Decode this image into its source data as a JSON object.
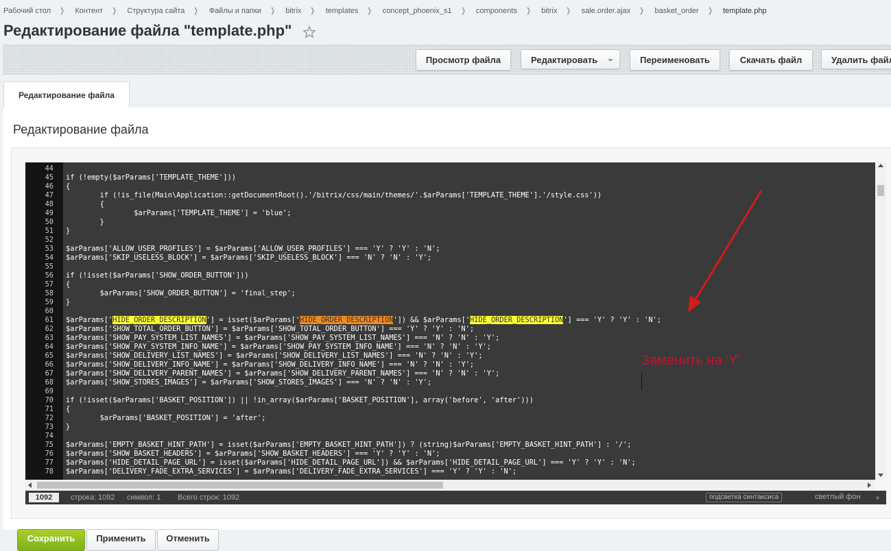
{
  "breadcrumbs": [
    "Рабочий стол",
    "Контент",
    "Структура сайта",
    "Файлы и папки",
    "bitrix",
    "templates",
    "concept_phoenix_s1",
    "components",
    "bitrix",
    "sale.order.ajax",
    "basket_order",
    "template.php"
  ],
  "page_title": "Редактирование файла \"template.php\"",
  "toolbar": {
    "view_file": "Просмотр файла",
    "edit": "Редактировать",
    "rename": "Переименовать",
    "download": "Скачать файл",
    "delete": "Удалить файл"
  },
  "tab_label": "Редактирование файла",
  "section_title": "Редактирование файла",
  "editor": {
    "lines": [
      {
        "n": "44",
        "parts": [
          {
            "t": ""
          }
        ]
      },
      {
        "n": "45",
        "parts": [
          {
            "t": "if (!empty($arParams['TEMPLATE_THEME']))"
          }
        ]
      },
      {
        "n": "46",
        "parts": [
          {
            "t": "{"
          }
        ]
      },
      {
        "n": "47",
        "parts": [
          {
            "t": "\tif (!is_file(Main\\Application::getDocumentRoot().'/bitrix/css/main/themes/'.$arParams['TEMPLATE_THEME'].'/style.css'))"
          }
        ]
      },
      {
        "n": "48",
        "parts": [
          {
            "t": "\t{"
          }
        ]
      },
      {
        "n": "49",
        "parts": [
          {
            "t": "\t\t$arParams['TEMPLATE_THEME'] = 'blue';"
          }
        ]
      },
      {
        "n": "50",
        "parts": [
          {
            "t": "\t}"
          }
        ]
      },
      {
        "n": "51",
        "parts": [
          {
            "t": "}"
          }
        ]
      },
      {
        "n": "52",
        "parts": [
          {
            "t": ""
          }
        ]
      },
      {
        "n": "53",
        "parts": [
          {
            "t": "$arParams['ALLOW_USER_PROFILES'] = $arParams['ALLOW_USER_PROFILES'] === 'Y' ? 'Y' : 'N';"
          }
        ]
      },
      {
        "n": "54",
        "parts": [
          {
            "t": "$arParams['SKIP_USELESS_BLOCK'] = $arParams['SKIP_USELESS_BLOCK'] === 'N' ? 'N' : 'Y';"
          }
        ]
      },
      {
        "n": "55",
        "parts": [
          {
            "t": ""
          }
        ]
      },
      {
        "n": "56",
        "parts": [
          {
            "t": "if (!isset($arParams['SHOW_ORDER_BUTTON']))"
          }
        ]
      },
      {
        "n": "57",
        "parts": [
          {
            "t": "{"
          }
        ]
      },
      {
        "n": "58",
        "parts": [
          {
            "t": "\t$arParams['SHOW_ORDER_BUTTON'] = 'final_step';"
          }
        ]
      },
      {
        "n": "59",
        "parts": [
          {
            "t": "}"
          }
        ]
      },
      {
        "n": "60",
        "parts": [
          {
            "t": ""
          }
        ]
      },
      {
        "n": "61",
        "parts": [
          {
            "t": "$arParams['"
          },
          {
            "t": "HIDE_ORDER_DESCRIPTION",
            "hl": "yellow"
          },
          {
            "t": "'] = isset($arParams['"
          },
          {
            "t": "HIDE_ORDER_DESCRIPTION",
            "hl": "orange"
          },
          {
            "t": "']) && $arParams['"
          },
          {
            "t": "HIDE_ORDER_DESCRIPTION",
            "hl": "yellow"
          },
          {
            "t": "'] === 'Y' ? 'Y' : 'N';"
          }
        ]
      },
      {
        "n": "62",
        "parts": [
          {
            "t": "$arParams['SHOW_TOTAL_ORDER_BUTTON'] = $arParams['SHOW_TOTAL_ORDER_BUTTON'] === 'Y' ? 'Y' : 'N';"
          }
        ]
      },
      {
        "n": "63",
        "parts": [
          {
            "t": "$arParams['SHOW_PAY_SYSTEM_LIST_NAMES'] = $arParams['SHOW_PAY_SYSTEM_LIST_NAMES'] === 'N' ? 'N' : 'Y';"
          }
        ]
      },
      {
        "n": "64",
        "parts": [
          {
            "t": "$arParams['SHOW_PAY_SYSTEM_INFO_NAME'] = $arParams['SHOW_PAY_SYSTEM_INFO_NAME'] === 'N' ? 'N' : 'Y';"
          }
        ]
      },
      {
        "n": "65",
        "parts": [
          {
            "t": "$arParams['SHOW_DELIVERY_LIST_NAMES'] = $arParams['SHOW_DELIVERY_LIST_NAMES'] === 'N' ? 'N' : 'Y';"
          }
        ]
      },
      {
        "n": "66",
        "parts": [
          {
            "t": "$arParams['SHOW_DELIVERY_INFO_NAME'] = $arParams['SHOW_DELIVERY_INFO_NAME'] === 'N' ? 'N' : 'Y';"
          }
        ]
      },
      {
        "n": "67",
        "parts": [
          {
            "t": "$arParams['SHOW_DELIVERY_PARENT_NAMES'] = $arParams['SHOW_DELIVERY_PARENT_NAMES'] === 'N' ? 'N' : 'Y';"
          }
        ]
      },
      {
        "n": "68",
        "parts": [
          {
            "t": "$arParams['SHOW_STORES_IMAGES'] = $arParams['SHOW_STORES_IMAGES'] === 'N' ? 'N' : 'Y';"
          }
        ]
      },
      {
        "n": "69",
        "parts": [
          {
            "t": ""
          }
        ]
      },
      {
        "n": "70",
        "parts": [
          {
            "t": "if (!isset($arParams['BASKET_POSITION']) || !in_array($arParams['BASKET_POSITION'], array('before', 'after')))"
          }
        ]
      },
      {
        "n": "71",
        "parts": [
          {
            "t": "{"
          }
        ]
      },
      {
        "n": "72",
        "parts": [
          {
            "t": "\t$arParams['BASKET_POSITION'] = 'after';"
          }
        ]
      },
      {
        "n": "73",
        "parts": [
          {
            "t": "}"
          }
        ]
      },
      {
        "n": "74",
        "parts": [
          {
            "t": ""
          }
        ]
      },
      {
        "n": "75",
        "parts": [
          {
            "t": "$arParams['EMPTY_BASKET_HINT_PATH'] = isset($arParams['EMPTY_BASKET_HINT_PATH']) ? (string)$arParams['EMPTY_BASKET_HINT_PATH'] : '/';"
          }
        ]
      },
      {
        "n": "76",
        "parts": [
          {
            "t": "$arParams['SHOW_BASKET_HEADERS'] = $arParams['SHOW_BASKET_HEADERS'] === 'Y' ? 'Y' : 'N';"
          }
        ]
      },
      {
        "n": "77",
        "parts": [
          {
            "t": "$arParams['HIDE_DETAIL_PAGE_URL'] = isset($arParams['HIDE_DETAIL_PAGE_URL']) && $arParams['HIDE_DETAIL_PAGE_URL'] === 'Y' ? 'Y' : 'N';"
          }
        ]
      },
      {
        "n": "78",
        "parts": [
          {
            "t": "$arParams['DELIVERY_FADE_EXTRA_SERVICES'] = $arParams['DELIVERY_FADE_EXTRA_SERVICES'] === 'Y' ? 'Y' : 'N';"
          }
        ]
      }
    ]
  },
  "statusbar": {
    "goto_line": "1092",
    "row": "строка: 1092",
    "col": "символ: 1",
    "total": "Всего строк: 1092",
    "syntax_toggle": "подсветка синтаксиса",
    "theme_toggle": "светлый фон"
  },
  "annotation": {
    "text": "Заменить на 'Y'",
    "color": "#c8102e"
  },
  "buttons": {
    "save": "Сохранить",
    "apply": "Применить",
    "cancel": "Отменить"
  },
  "colors": {
    "highlight_yellow": "#ffff33",
    "highlight_orange": "#f08a24",
    "editor_bg": "#3a3a3a",
    "save_green": "#8cbf1e"
  }
}
